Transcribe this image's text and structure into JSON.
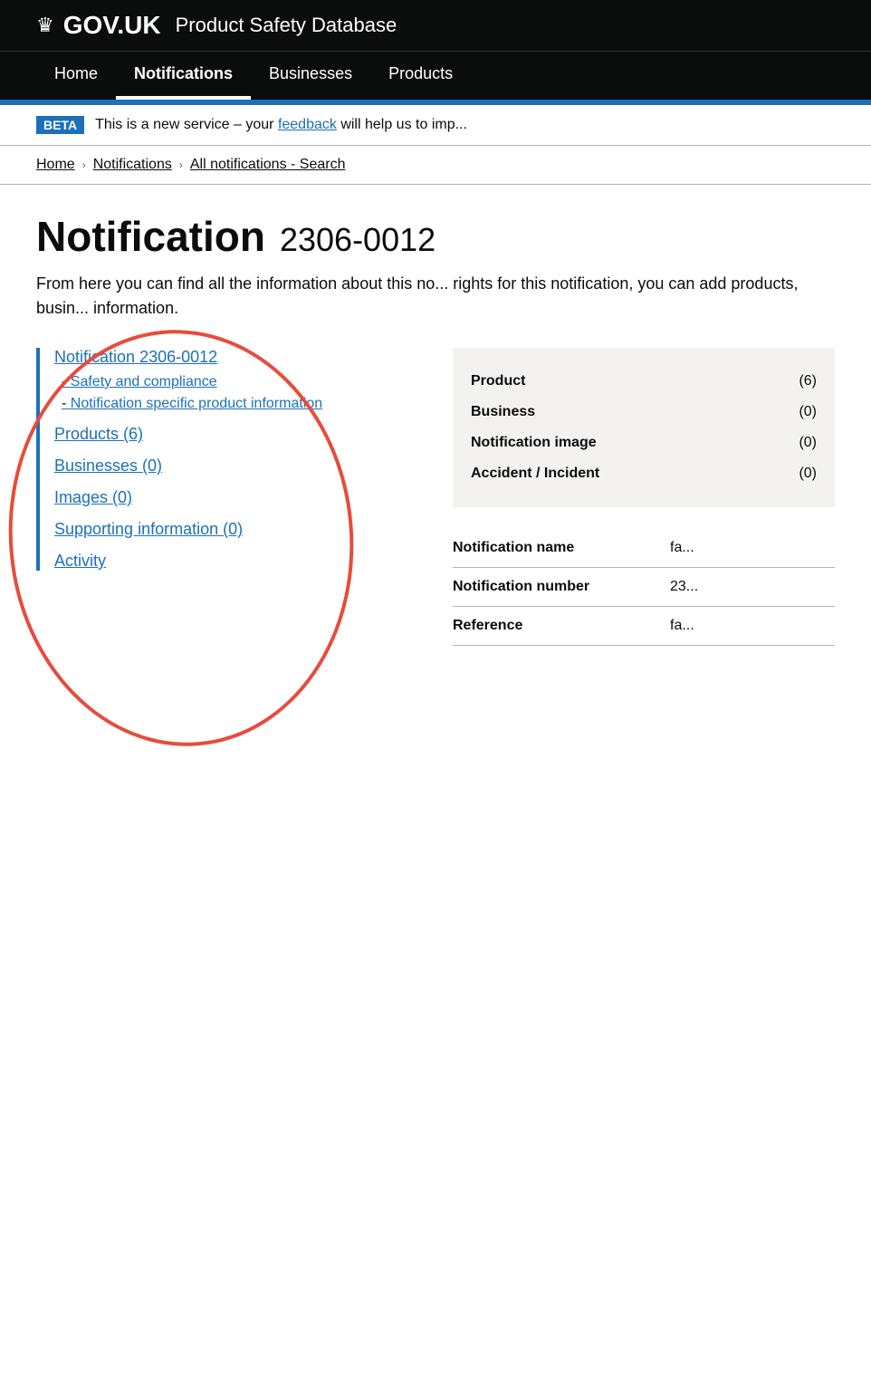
{
  "header": {
    "logo_crown": "♛",
    "logo_text": "GOV.UK",
    "subtitle": "Product Safety Database"
  },
  "nav": {
    "items": [
      {
        "label": "Home",
        "active": false
      },
      {
        "label": "Notifications",
        "active": true
      },
      {
        "label": "Businesses",
        "active": false
      },
      {
        "label": "Products",
        "active": false
      }
    ]
  },
  "beta_banner": {
    "tag": "BETA",
    "text": "This is a new service – your ",
    "link_text": "feedback",
    "text_after": " will help us to imp..."
  },
  "breadcrumb": {
    "items": [
      {
        "label": "Home",
        "link": true
      },
      {
        "label": "Notifications",
        "link": true
      },
      {
        "label": "All notifications - Search",
        "link": true
      }
    ]
  },
  "page": {
    "title": "Notification",
    "notification_id": "2306-0012",
    "description": "From here you can find all the information about this no... rights for this notification, you can add products, busin... information."
  },
  "sidebar": {
    "main_link_label": "Notification",
    "main_link_id": "2306-0012",
    "sub_links": [
      {
        "prefix": "- ",
        "label": "Safety and compliance"
      },
      {
        "prefix": "- ",
        "label": "Notification specific product information"
      }
    ],
    "section_links": [
      {
        "label": "Products (6)"
      },
      {
        "label": "Businesses (0)"
      },
      {
        "label": "Images (0)"
      },
      {
        "label": "Supporting information (0)"
      },
      {
        "label": "Activity"
      }
    ]
  },
  "summary_box": {
    "rows": [
      {
        "label": "Product",
        "value": "(6)"
      },
      {
        "label": "Business",
        "value": "(0)"
      },
      {
        "label": "Notification image",
        "value": "(0)"
      },
      {
        "label": "Accident / Incident",
        "value": "(0)"
      }
    ]
  },
  "detail_table": {
    "rows": [
      {
        "key": "Notification name",
        "value": "fa..."
      },
      {
        "key": "Notification number",
        "value": "23..."
      },
      {
        "key": "Reference",
        "value": "fa..."
      }
    ]
  }
}
